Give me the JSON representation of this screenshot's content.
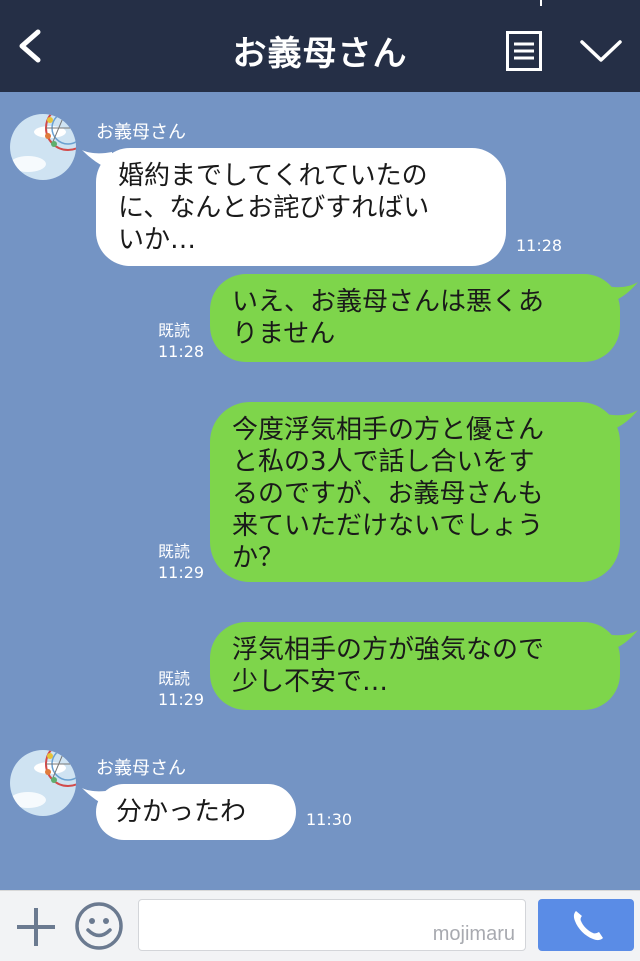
{
  "header": {
    "title": "お義母さん",
    "back_icon": "chevron-left-icon",
    "menu_icon": "menu-lines-icon",
    "expand_icon": "chevron-down-icon",
    "background": "#252f46"
  },
  "chat": {
    "background": "#7494c4",
    "messages": [
      {
        "side": "in",
        "sender": "お義母さん",
        "lines": [
          "婚約までしてくれていたの",
          "に、なんとお詫びすればい",
          "いか…"
        ],
        "time": "11:28"
      },
      {
        "side": "out",
        "read": "既読",
        "lines": [
          "いえ、お義母さんは悪くあ",
          "りません"
        ],
        "time": "11:28"
      },
      {
        "side": "out",
        "read": "既読",
        "lines": [
          "今度浮気相手の方と優さん",
          "と私の3人で話し合いをす",
          "るのですが、お義母さんも",
          "来ていただけないでしょう",
          "か？"
        ],
        "time": "11:29"
      },
      {
        "side": "out",
        "read": "既読",
        "lines": [
          "浮気相手の方が強気なので",
          "少し不安で…"
        ],
        "time": "11:29"
      },
      {
        "side": "in",
        "sender": "お義母さん",
        "lines": [
          "分かったわ"
        ],
        "time": "11:30"
      }
    ],
    "incoming_color": "#ffffff",
    "outgoing_color": "#7ed54b"
  },
  "input_bar": {
    "placeholder": "",
    "watermark": "mojimaru",
    "plus_icon": "plus-icon",
    "emoji_icon": "smiley-icon",
    "call_icon": "phone-icon",
    "call_color": "#5a8ce6"
  }
}
